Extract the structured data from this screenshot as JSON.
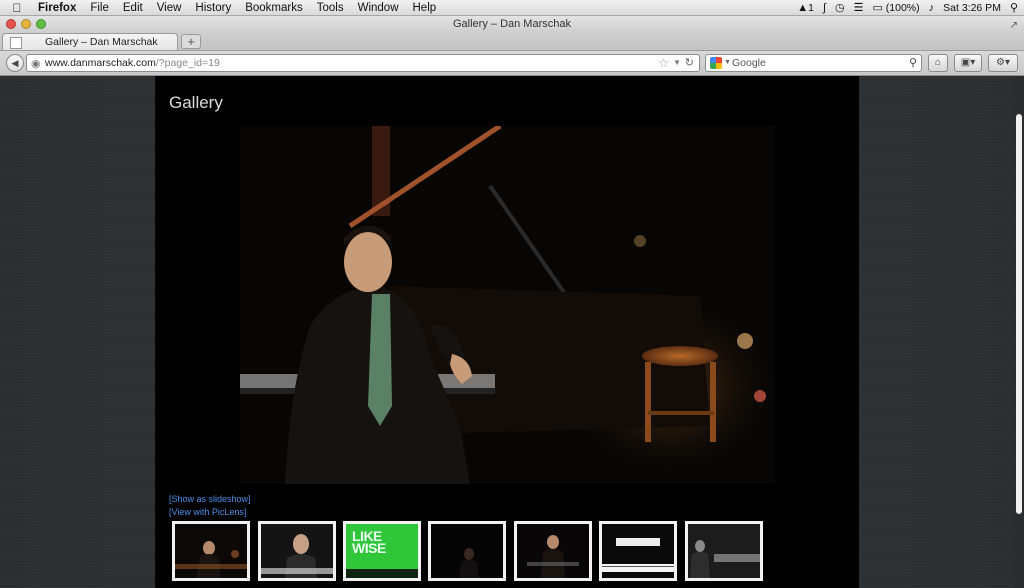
{
  "menubar": {
    "app_name": "Firefox",
    "items": [
      "File",
      "Edit",
      "View",
      "History",
      "Bookmarks",
      "Tools",
      "Window",
      "Help"
    ],
    "status": {
      "adobe_count": "1",
      "battery": "(100%)",
      "clock": "Sat 3:26 PM"
    }
  },
  "window": {
    "title": "Gallery – Dan Marschak"
  },
  "tabs": [
    {
      "label": "Gallery – Dan Marschak"
    }
  ],
  "toolbar": {
    "url_host": "www.danmarschak.com",
    "url_path": "/?page_id=19",
    "search_placeholder": "Google",
    "search_engine_icon": "google-icon"
  },
  "page": {
    "title": "Gallery",
    "links": {
      "slideshow": "[Show as slideshow]",
      "piclens": "[View with PicLens]"
    },
    "thumbnails": [
      {
        "subject": "pianist-stage"
      },
      {
        "subject": "pianist-portrait"
      },
      {
        "subject": "likewise-album-cover",
        "text": "LIKE WISE"
      },
      {
        "subject": "dark-stage"
      },
      {
        "subject": "pianist-seated"
      },
      {
        "subject": "grand-piano"
      },
      {
        "subject": "pianist-playing-bw"
      }
    ]
  },
  "colors": {
    "page_background": "#000000",
    "link": "#4f8ee8",
    "likewise_green": "#2fc63a"
  }
}
